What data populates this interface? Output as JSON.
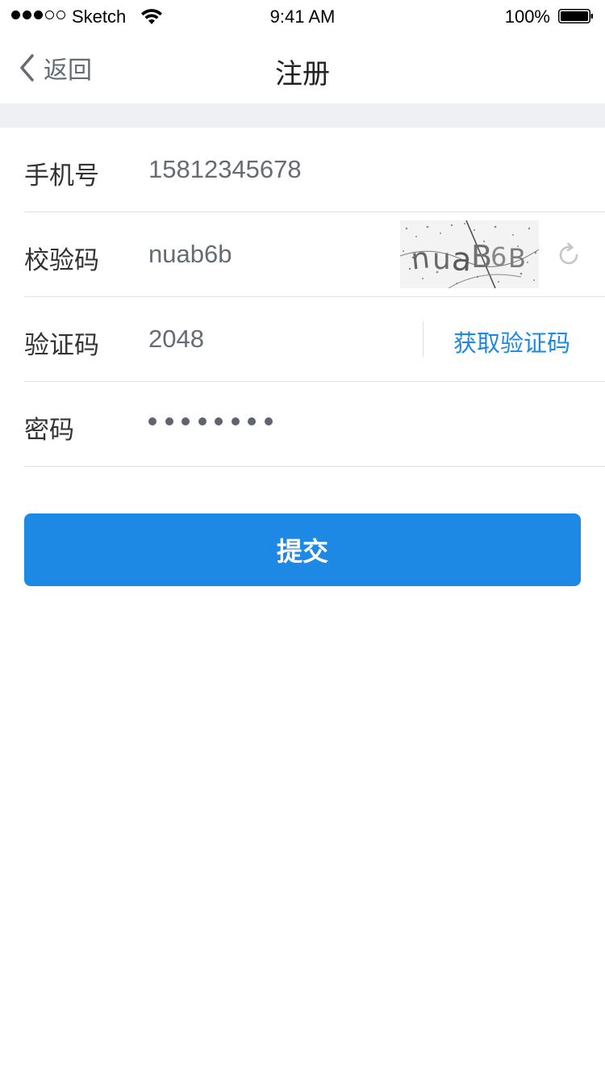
{
  "status_bar": {
    "carrier": "Sketch",
    "time": "9:41 AM",
    "battery": "100%",
    "signal_bars_filled": 3,
    "signal_bars_total": 5
  },
  "nav": {
    "back_label": "返回",
    "title": "注册",
    "back_icon": "chevron-left-icon"
  },
  "form": {
    "phone": {
      "label": "手机号",
      "value": "15812345678"
    },
    "captcha": {
      "label": "校验码",
      "value": "nuab6b",
      "refresh_icon": "refresh-icon"
    },
    "sms_code": {
      "label": "验证码",
      "value": "2048",
      "get_code_label": "获取验证码"
    },
    "password": {
      "label": "密码",
      "masked_length": 8
    }
  },
  "submit_label": "提交",
  "colors": {
    "accent": "#1e88e5",
    "band": "#eef0f3",
    "divider": "#e2e3e6"
  }
}
